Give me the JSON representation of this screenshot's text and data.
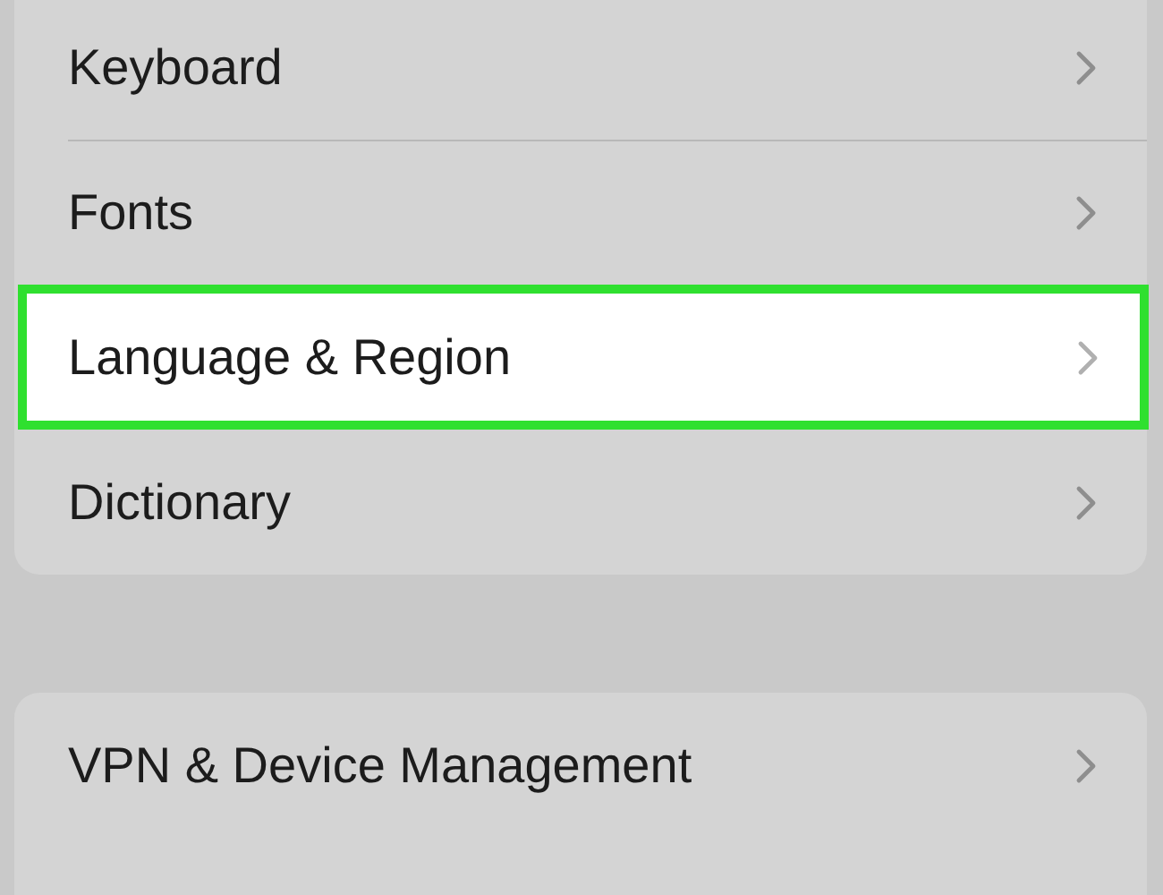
{
  "groups": [
    {
      "items": [
        {
          "label": "Keyboard",
          "highlighted": false
        },
        {
          "label": "Fonts",
          "highlighted": false
        },
        {
          "label": "Language & Region",
          "highlighted": true
        },
        {
          "label": "Dictionary",
          "highlighted": false
        }
      ]
    },
    {
      "items": [
        {
          "label": "VPN & Device Management",
          "highlighted": false
        }
      ]
    }
  ]
}
